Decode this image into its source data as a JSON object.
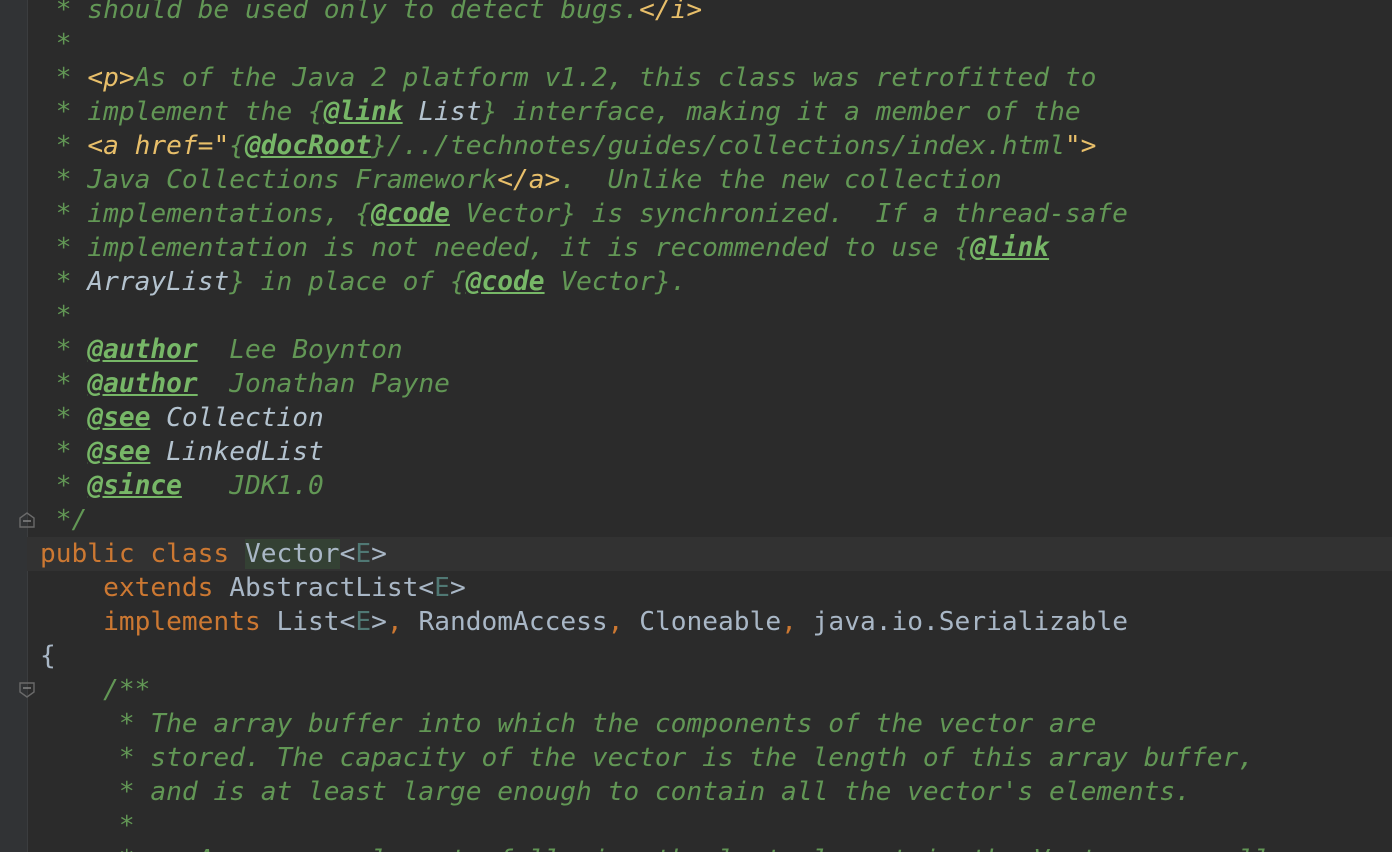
{
  "editor": {
    "lines": [
      [
        {
          "t": " * should be used only to detect bugs.",
          "c": "doc"
        },
        {
          "t": "</i>",
          "c": "html"
        }
      ],
      [
        {
          "t": " *",
          "c": "doc"
        }
      ],
      [
        {
          "t": " * ",
          "c": "doc"
        },
        {
          "t": "<p>",
          "c": "html"
        },
        {
          "t": "As of the Java 2 platform v1.2, this class was retrofitted to",
          "c": "doc"
        }
      ],
      [
        {
          "t": " * implement the {",
          "c": "doc"
        },
        {
          "t": "@link",
          "c": "tag"
        },
        {
          "t": " List",
          "c": "ref"
        },
        {
          "t": "} interface, making it a member of the",
          "c": "doc"
        }
      ],
      [
        {
          "t": " * ",
          "c": "doc"
        },
        {
          "t": "<a href=\"",
          "c": "html"
        },
        {
          "t": "{",
          "c": "doc"
        },
        {
          "t": "@docRoot",
          "c": "tag"
        },
        {
          "t": "}/../technotes/guides/collections/index.html",
          "c": "doc"
        },
        {
          "t": "\">",
          "c": "html"
        }
      ],
      [
        {
          "t": " * Java Collections Framework",
          "c": "doc"
        },
        {
          "t": "</a>",
          "c": "html"
        },
        {
          "t": ".  Unlike the new collection",
          "c": "doc"
        }
      ],
      [
        {
          "t": " * implementations, {",
          "c": "doc"
        },
        {
          "t": "@code",
          "c": "tag"
        },
        {
          "t": " Vector} is synchronized.  If a thread-safe",
          "c": "doc"
        }
      ],
      [
        {
          "t": " * implementation is not needed, it is recommended to use {",
          "c": "doc"
        },
        {
          "t": "@link",
          "c": "tag"
        }
      ],
      [
        {
          "t": " * ",
          "c": "doc"
        },
        {
          "t": "ArrayList",
          "c": "ref"
        },
        {
          "t": "} in place of {",
          "c": "doc"
        },
        {
          "t": "@code",
          "c": "tag"
        },
        {
          "t": " Vector}.",
          "c": "doc"
        }
      ],
      [
        {
          "t": " *",
          "c": "doc"
        }
      ],
      [
        {
          "t": " * ",
          "c": "doc"
        },
        {
          "t": "@author",
          "c": "tag"
        },
        {
          "t": "  Lee Boynton",
          "c": "doc"
        }
      ],
      [
        {
          "t": " * ",
          "c": "doc"
        },
        {
          "t": "@author",
          "c": "tag"
        },
        {
          "t": "  Jonathan Payne",
          "c": "doc"
        }
      ],
      [
        {
          "t": " * ",
          "c": "doc"
        },
        {
          "t": "@see",
          "c": "tag"
        },
        {
          "t": " Collection",
          "c": "ref"
        }
      ],
      [
        {
          "t": " * ",
          "c": "doc"
        },
        {
          "t": "@see",
          "c": "tag"
        },
        {
          "t": " LinkedList",
          "c": "ref"
        }
      ],
      [
        {
          "t": " * ",
          "c": "doc"
        },
        {
          "t": "@since",
          "c": "tag"
        },
        {
          "t": "   JDK1.0",
          "c": "doc"
        }
      ],
      [
        {
          "t": " */",
          "c": "doc"
        }
      ],
      [
        {
          "t": "public class ",
          "c": "kw"
        },
        {
          "t": "|",
          "c": "caret"
        },
        {
          "t": "Vector",
          "c": "hl"
        },
        {
          "t": "<",
          "c": "plain"
        },
        {
          "t": "E",
          "c": "tp"
        },
        {
          "t": ">",
          "c": "plain"
        }
      ],
      [
        {
          "t": "    extends ",
          "c": "kw"
        },
        {
          "t": "AbstractList<",
          "c": "plain"
        },
        {
          "t": "E",
          "c": "tp"
        },
        {
          "t": ">",
          "c": "plain"
        }
      ],
      [
        {
          "t": "    implements ",
          "c": "kw"
        },
        {
          "t": "List<",
          "c": "plain"
        },
        {
          "t": "E",
          "c": "tp"
        },
        {
          "t": ">",
          "c": "plain"
        },
        {
          "t": ", ",
          "c": "kw"
        },
        {
          "t": "RandomAccess",
          "c": "plain"
        },
        {
          "t": ", ",
          "c": "kw"
        },
        {
          "t": "Cloneable",
          "c": "plain"
        },
        {
          "t": ", ",
          "c": "kw"
        },
        {
          "t": "java.io.Serializable",
          "c": "plain"
        }
      ],
      [
        {
          "t": "{",
          "c": "plain"
        }
      ],
      [
        {
          "t": "    /**",
          "c": "doc"
        }
      ],
      [
        {
          "t": "     * The array buffer into which the components of the vector are",
          "c": "doc"
        }
      ],
      [
        {
          "t": "     * stored. The capacity of the vector is the length of this array buffer,",
          "c": "doc"
        }
      ],
      [
        {
          "t": "     * and is at least large enough to contain all the vector's elements.",
          "c": "doc"
        }
      ],
      [
        {
          "t": "     *",
          "c": "doc"
        }
      ],
      [
        {
          "t": "     * <p>Any array elements following the last element in the Vector are null.",
          "c": "doc"
        }
      ]
    ],
    "current_line": 16,
    "fold_markers": [
      {
        "line": 15,
        "icon": "fold-end-icon"
      },
      {
        "line": 20,
        "icon": "fold-start-icon"
      }
    ]
  }
}
